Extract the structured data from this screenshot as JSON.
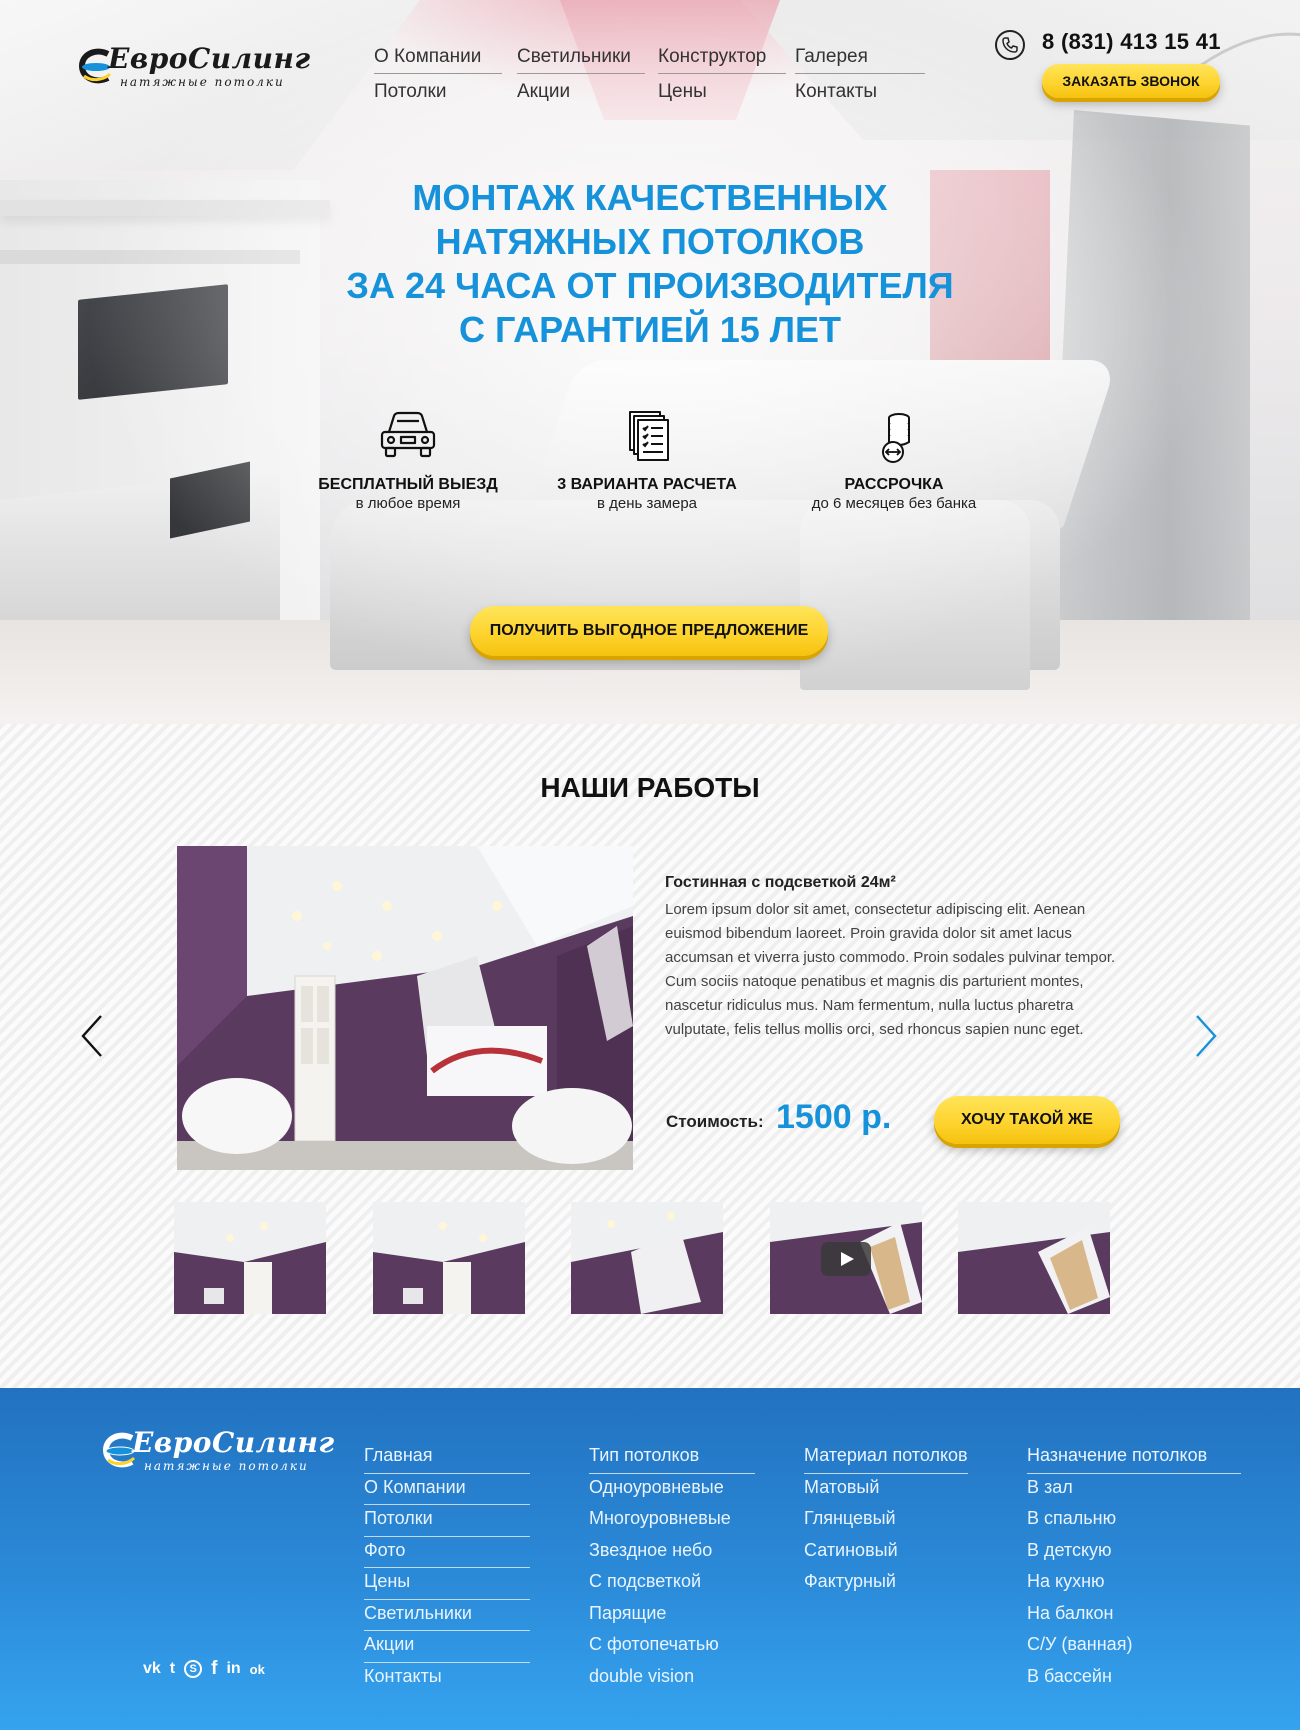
{
  "brand": {
    "name": "ЕвроСилинг",
    "tagline": "натяжные потолки",
    "colors": {
      "primary": "#1592da",
      "accent": "#fdd22c",
      "footer": "#2b8ad8"
    }
  },
  "header": {
    "nav": [
      "О Компании",
      "Светильники",
      "Конструктор",
      "Галерея",
      "Потолки",
      "Акции",
      "Цены",
      "Контакты"
    ],
    "phone": "8 (831) 413 15 41",
    "phone_icon": "phone-icon",
    "callback_button": "ЗАКАЗАТЬ ЗВОНОК"
  },
  "hero": {
    "headline": [
      "МОНТАЖ КАЧЕСТВЕННЫХ",
      "НАТЯЖНЫХ ПОТОЛКОВ",
      "ЗА 24 ЧАСА ОТ ПРОИЗВОДИТЕЛЯ",
      "С ГАРАНТИЕЙ 15 ЛЕТ"
    ],
    "features": [
      {
        "icon": "car-icon",
        "title": "БЕСПЛАТНЫЙ ВЫЕЗД",
        "subtitle": "в любое время"
      },
      {
        "icon": "documents-icon",
        "title": "3 ВАРИАНТА РАСЧЕТА",
        "subtitle": "в день замера"
      },
      {
        "icon": "coins-icon",
        "title": "РАССРОЧКА",
        "subtitle": "до 6 месяцев без банка"
      }
    ],
    "cta_button": "ПОЛУЧИТЬ ВЫГОДНОЕ ПРЕДЛОЖЕНИЕ"
  },
  "works": {
    "title": "НАШИ РАБОТЫ",
    "item": {
      "title": "Гостинная с подсветкой 24м²",
      "description": "Lorem ipsum dolor sit amet, consectetur adipiscing elit. Aenean euismod bibendum laoreet. Proin gravida dolor sit amet lacus accumsan et viverra justo commodo. Proin sodales pulvinar tempor. Cum sociis natoque penatibus et magnis dis parturient montes, nascetur ridiculus mus. Nam fermentum, nulla luctus pharetra vulputate, felis tellus mollis orci, sed rhoncus sapien nunc eget.",
      "price_label": "Стоимость:",
      "price": "1500 р.",
      "button": "ХОЧУ ТАКОЙ ЖЕ"
    },
    "thumbnails_count": 5,
    "video_thumbnail_index": 3
  },
  "footer": {
    "col1": [
      "Главная",
      "О Компании",
      "Потолки",
      "Фото",
      "Цены",
      "Светильники",
      "Акции",
      "Контакты"
    ],
    "col2": [
      "Тип потолков",
      "Одноуровневые",
      "Многоуровневые",
      "Звездное небо",
      "С подсветкой",
      "Парящие",
      "С фотопечатью",
      "double vision"
    ],
    "col3": [
      "Материал потолков",
      "Матовый",
      "Глянцевый",
      "Сатиновый",
      "Фактурный"
    ],
    "col4": [
      "Назначение потолков",
      "В зал",
      "В спальню",
      "В детскую",
      "На кухню",
      "На балкон",
      "С/У (ванная)",
      "В бассейн"
    ],
    "social": [
      {
        "icon": "vk-icon",
        "glyph": "vk"
      },
      {
        "icon": "twitter-icon",
        "glyph": "t"
      },
      {
        "icon": "skype-icon",
        "glyph": "S"
      },
      {
        "icon": "facebook-icon",
        "glyph": "f"
      },
      {
        "icon": "linkedin-icon",
        "glyph": "in"
      },
      {
        "icon": "odnoklassniki-icon",
        "glyph": "ok"
      }
    ]
  }
}
